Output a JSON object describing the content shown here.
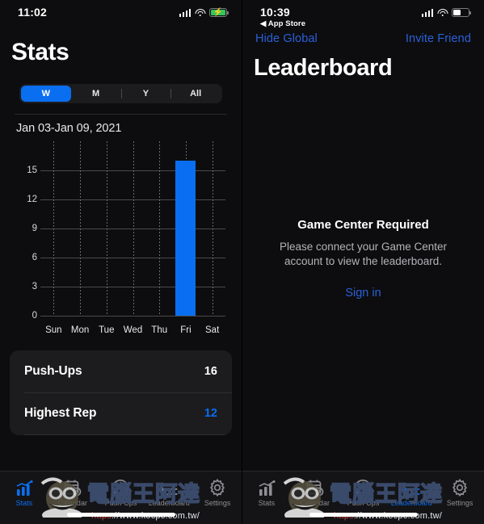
{
  "left": {
    "status": {
      "time": "11:02",
      "battery_state": "charging",
      "signal_icon": "cellular-bars-icon",
      "wifi_icon": "wifi-icon",
      "battery_icon": "battery-charging-icon"
    },
    "title": "Stats",
    "segmented": {
      "options": [
        "W",
        "M",
        "Y",
        "All"
      ],
      "selected": "W"
    },
    "chart_data": {
      "type": "bar",
      "title": "Jan 03-Jan 09, 2021",
      "categories": [
        "Sun",
        "Mon",
        "Tue",
        "Wed",
        "Thu",
        "Fri",
        "Sat"
      ],
      "values": [
        0,
        0,
        0,
        0,
        0,
        16,
        0
      ],
      "yticks": [
        0,
        3,
        6,
        9,
        12,
        15
      ],
      "ylim": [
        0,
        17
      ],
      "xlabel": "",
      "ylabel": "",
      "grid": true,
      "legend": "none",
      "bar_color": "#0a6ef0"
    },
    "stats": [
      {
        "label": "Push-Ups",
        "value": "16",
        "value_color": "white"
      },
      {
        "label": "Highest Rep",
        "value": "12",
        "value_color": "blue"
      }
    ],
    "tabs": [
      {
        "label": "Stats",
        "icon": "chart-bars-icon",
        "active": true
      },
      {
        "label": "Calendar",
        "icon": "calendar-clock-icon",
        "active": false
      },
      {
        "label": "Push-Ups",
        "icon": "circle-icon",
        "active": false
      },
      {
        "label": "Leaderboard",
        "icon": "list-star-icon",
        "active": false
      },
      {
        "label": "Settings",
        "icon": "gear-icon",
        "active": false
      }
    ]
  },
  "right": {
    "status": {
      "time": "10:39",
      "back_label": "◀ App Store",
      "battery_state": "normal",
      "signal_icon": "cellular-bars-icon",
      "wifi_icon": "wifi-icon",
      "battery_icon": "battery-icon"
    },
    "nav": {
      "left_button": "Hide Global",
      "right_button": "Invite Friend"
    },
    "title": "Leaderboard",
    "empty_state": {
      "heading": "Game Center Required",
      "message": "Please connect your Game Center account to view the leaderboard.",
      "action": "Sign in"
    },
    "tabs": [
      {
        "label": "Stats",
        "icon": "chart-bars-icon",
        "active": false
      },
      {
        "label": "Calendar",
        "icon": "calendar-clock-icon",
        "active": false
      },
      {
        "label": "Push-Ups",
        "icon": "circle-icon",
        "active": false
      },
      {
        "label": "Leaderboard",
        "icon": "list-star-icon",
        "active": true
      },
      {
        "label": "Settings",
        "icon": "gear-icon",
        "active": false
      }
    ]
  },
  "watermark": {
    "text": "電腦王阿達",
    "url": "https://www.kocpc.com.tw/",
    "url_prefix": "https"
  }
}
